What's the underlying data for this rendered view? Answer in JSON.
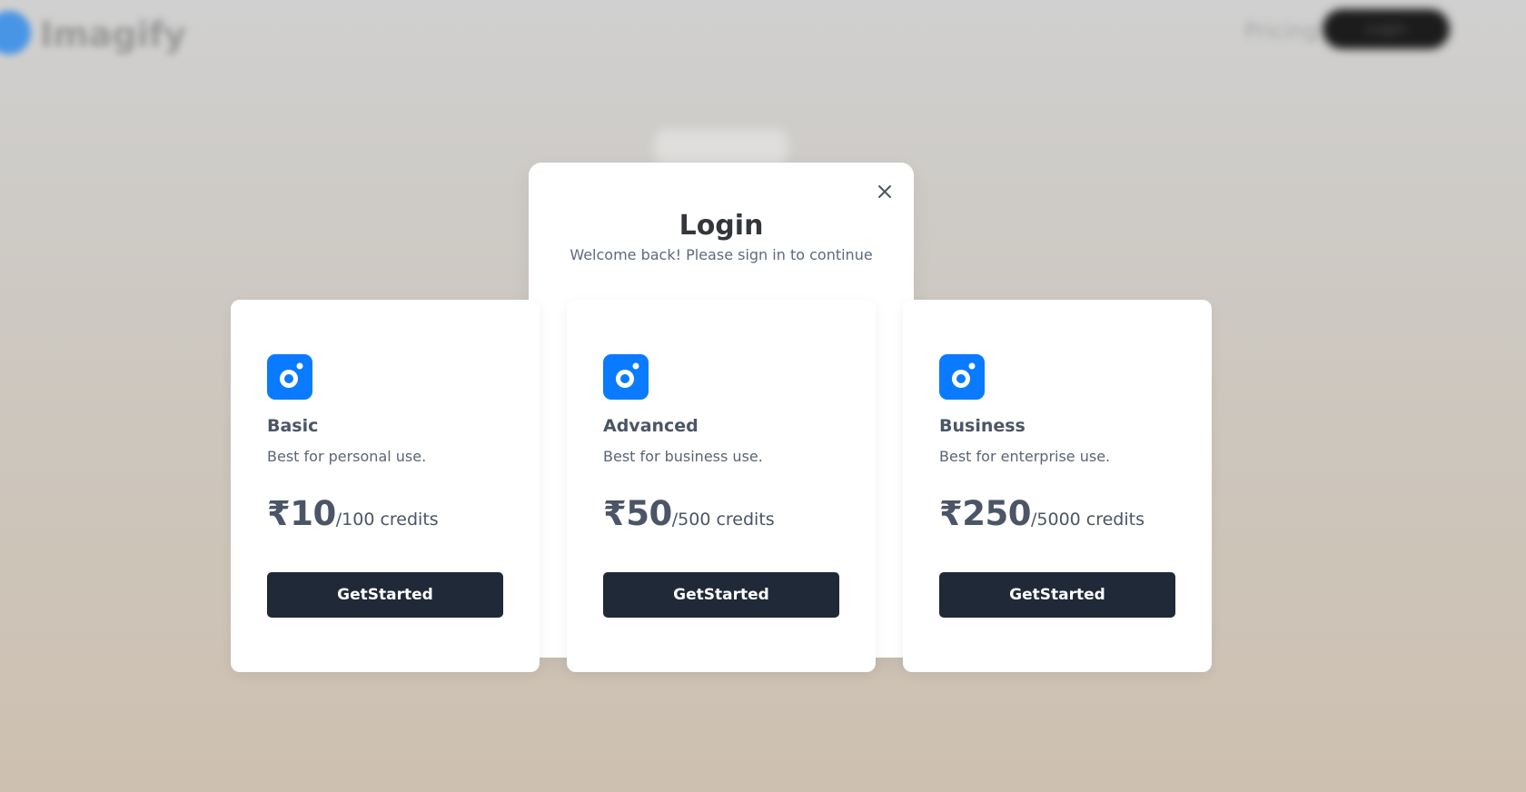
{
  "background": {
    "brand": "Imagify",
    "nav_link": "Pricing",
    "nav_button": "Login"
  },
  "modal": {
    "title": "Login",
    "subtitle": "Welcome back! Please sign in to continue",
    "close_icon": "close-icon"
  },
  "plans": [
    {
      "name": "Basic",
      "description": "Best for personal use.",
      "currency": "₹",
      "price": "10",
      "credits": "/100 credits",
      "button": "GetStarted"
    },
    {
      "name": "Advanced",
      "description": "Best for business use.",
      "currency": "₹",
      "price": "50",
      "credits": "/500 credits",
      "button": "GetStarted"
    },
    {
      "name": "Business",
      "description": "Best for enterprise use.",
      "currency": "₹",
      "price": "250",
      "credits": "/5000 credits",
      "button": "GetStarted"
    }
  ],
  "colors": {
    "accent": "#0a7bff",
    "button_bg": "#1f2937",
    "text": "#4b5566"
  }
}
